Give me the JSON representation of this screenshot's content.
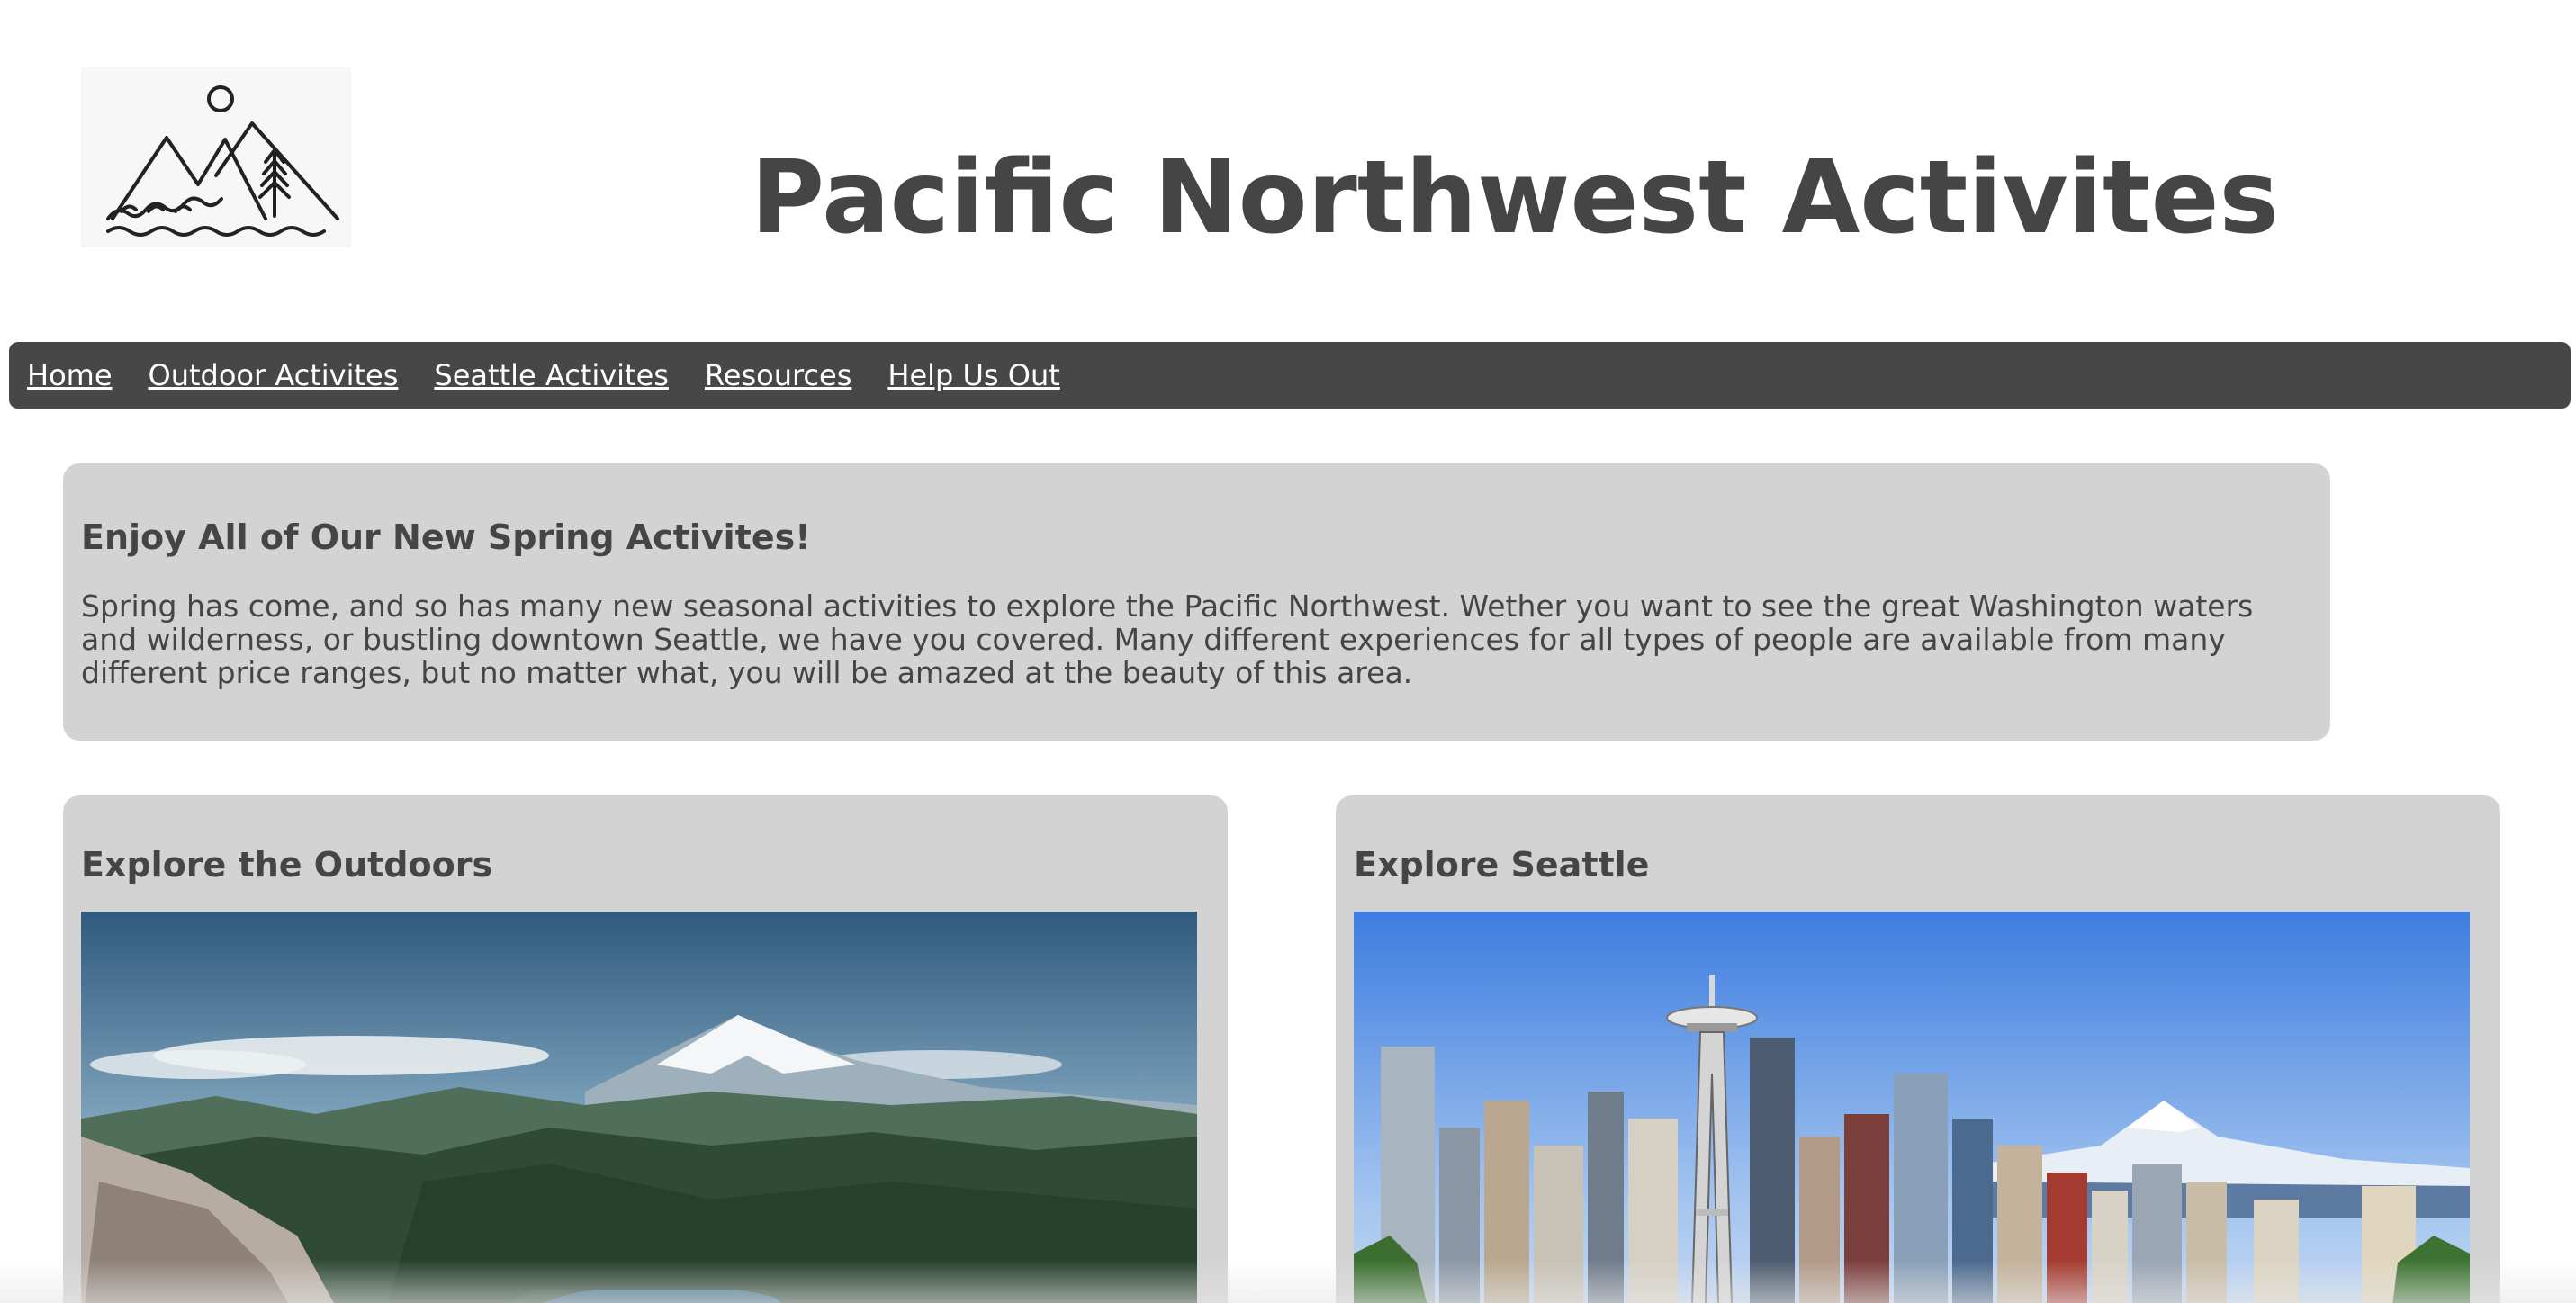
{
  "header": {
    "logo_icon": "mountain-sun-waves-logo-icon",
    "title": "Pacific Northwest Activites"
  },
  "nav": {
    "items": [
      {
        "label": "Home"
      },
      {
        "label": "Outdoor Activites"
      },
      {
        "label": "Seattle Activites"
      },
      {
        "label": "Resources"
      },
      {
        "label": "Help Us Out"
      }
    ]
  },
  "intro": {
    "heading": "Enjoy All of Our New Spring Activites!",
    "body": "Spring has come, and so has many new seasonal activities to explore the Pacific Northwest. Wether you want to see the great Washington waters and wilderness, or bustling downtown Seattle, we have you covered. Many different experiences for all types of people are available from many different price ranges, but no matter what, you will be amazed at the beauty of this area."
  },
  "cards": [
    {
      "heading": "Explore the Outdoors",
      "image": "mountain-landscape-image"
    },
    {
      "heading": "Explore Seattle",
      "image": "seattle-skyline-image"
    }
  ],
  "colors": {
    "nav_bg": "#474747",
    "panel_bg": "#d3d3d3",
    "text": "#454545",
    "nav_link": "#ffffff"
  }
}
